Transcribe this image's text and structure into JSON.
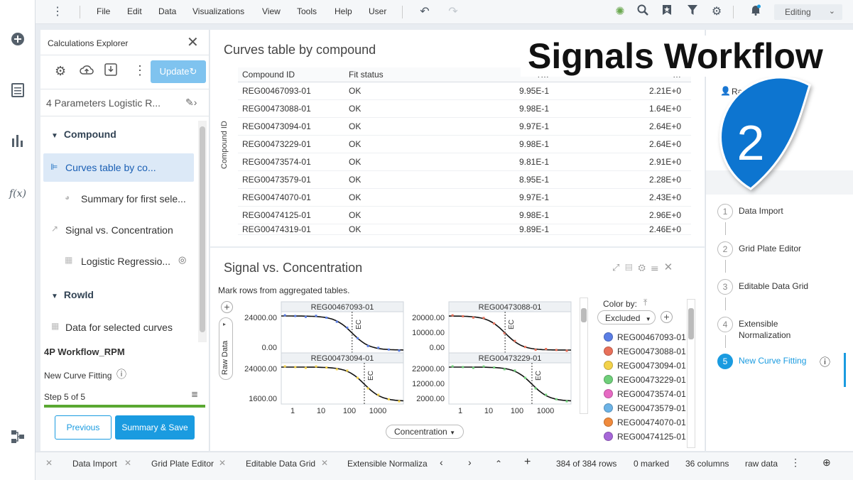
{
  "menu": [
    "File",
    "Edit",
    "Data",
    "Visualizations",
    "View",
    "Tools",
    "Help",
    "User"
  ],
  "mode": "Editing",
  "explorer": {
    "title": "Calculations Explorer",
    "update_label": "Update",
    "calc_name": "4 Parameters Logistic R...",
    "groups": [
      {
        "label": "Compound"
      },
      {
        "label": "RowId"
      }
    ],
    "items": [
      "Curves table by co...",
      "Summary for first sele...",
      "Signal vs. Concentration",
      "Logistic Regressio...",
      "Data for selected curves"
    ],
    "workflow_name": "4P Workflow_RPM",
    "step_name": "New Curve Fitting",
    "step_progress": "Step 5 of 5",
    "progress": 1.0,
    "prev_label": "Previous",
    "save_label": "Summary & Save"
  },
  "curves_table": {
    "title": "Curves table by compound",
    "side_label": "Compound ID",
    "headers": [
      "Compound ID",
      "Fit status",
      "r…",
      "…"
    ],
    "rows": [
      [
        "REG00467093-01",
        "OK",
        "9.95E-1",
        "2.21E+0"
      ],
      [
        "REG00473088-01",
        "OK",
        "9.98E-1",
        "1.64E+0"
      ],
      [
        "REG00473094-01",
        "OK",
        "9.97E-1",
        "2.64E+0"
      ],
      [
        "REG00473229-01",
        "OK",
        "9.98E-1",
        "2.64E+0"
      ],
      [
        "REG00473574-01",
        "OK",
        "9.81E-1",
        "2.91E+0"
      ],
      [
        "REG00473579-01",
        "OK",
        "8.95E-1",
        "2.28E+0"
      ],
      [
        "REG00474070-01",
        "OK",
        "9.97E-1",
        "2.43E+0"
      ],
      [
        "REG00474125-01",
        "OK",
        "9.98E-1",
        "2.96E+0"
      ],
      [
        "REG00474319-01",
        "OK",
        "9.89E-1",
        "2.46E+0"
      ]
    ]
  },
  "chart_panel": {
    "title": "Signal vs. Concentration",
    "subtitle": "Mark rows from aggregated tables.",
    "y_selector": "Raw Data",
    "x_selector": "Concentration",
    "color_by_label": "Color by:",
    "color_by_value": "Excluded",
    "ec_label": "EC"
  },
  "chart_data": [
    {
      "type": "line",
      "title": "REG00467093-01",
      "xscale": "log",
      "ytick_labels": [
        "24000.00",
        "0.00"
      ],
      "xtick_labels": [],
      "ylim": [
        -1000,
        26000
      ]
    },
    {
      "type": "line",
      "title": "REG00473088-01",
      "xscale": "log",
      "ytick_labels": [
        "20000.00",
        "10000.00",
        "0.00"
      ],
      "xtick_labels": [],
      "ylim": [
        -1000,
        24000
      ]
    },
    {
      "type": "line",
      "title": "REG00473094-01",
      "xscale": "log",
      "ytick_labels": [
        "24000.00",
        "1600.00"
      ],
      "xtick_labels": [
        "1",
        "10",
        "100",
        "1000"
      ],
      "ylim": [
        -1000,
        26000
      ]
    },
    {
      "type": "line",
      "title": "REG00473229-01",
      "xscale": "log",
      "ytick_labels": [
        "22000.00",
        "12000.00",
        "2000.00"
      ],
      "xtick_labels": [
        "1",
        "10",
        "100",
        "1000"
      ],
      "ylim": [
        -1000,
        24000
      ]
    }
  ],
  "legend": [
    {
      "label": "REG00467093-01",
      "color": "#5b7ee5"
    },
    {
      "label": "REG00473088-01",
      "color": "#e8705a"
    },
    {
      "label": "REG00473094-01",
      "color": "#f3d24a"
    },
    {
      "label": "REG00473229-01",
      "color": "#6fcf7a"
    },
    {
      "label": "REG00473574-01",
      "color": "#e66ac3"
    },
    {
      "label": "REG00473579-01",
      "color": "#6cb3e6"
    },
    {
      "label": "REG00474070-01",
      "color": "#f08a3c"
    },
    {
      "label": "REG00474125-01",
      "color": "#a667d8"
    }
  ],
  "right_panel": {
    "user": "Raquel Ro…",
    "steps": [
      {
        "num": "1",
        "label": "Data Import"
      },
      {
        "num": "2",
        "label": "Grid Plate Editor"
      },
      {
        "num": "3",
        "label": "Editable Data Grid"
      },
      {
        "num": "4",
        "label": "Extensible Normalization"
      },
      {
        "num": "5",
        "label": "New Curve Fitting"
      }
    ]
  },
  "statusbar": {
    "tabs": [
      "Data Import",
      "Grid Plate Editor",
      "Editable Data Grid",
      "Extensible Normaliza"
    ],
    "rows": "384 of 384 rows",
    "marked": "0 marked",
    "columns": "36 columns",
    "table": "raw data"
  },
  "overlay": {
    "title": "Signals Workflow",
    "badge": "2"
  },
  "colors": {
    "accent": "#1a9be0",
    "progress": "#5aa832",
    "badge": "#0b74d0"
  }
}
